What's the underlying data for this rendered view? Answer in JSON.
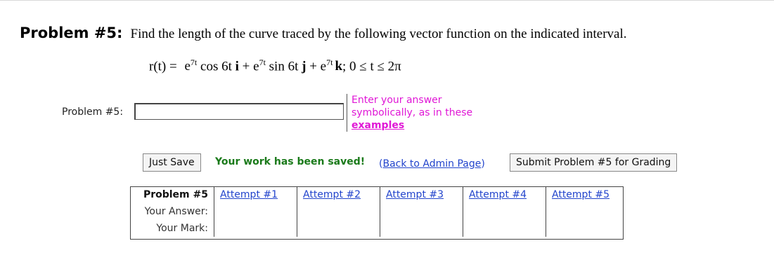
{
  "problem": {
    "heading_label": "Problem #5:",
    "heading_text": "Find the length of the curve traced by the following vector function on the indicated interval."
  },
  "formula": {
    "lhs": "r(t) =",
    "term1_base": "e",
    "term1_exp": "7t",
    "term1_rest": " cos 6t ",
    "term1_vec": "i",
    "plus1": " + ",
    "term2_base": "e",
    "term2_exp": "7t",
    "term2_rest": " sin 6t ",
    "term2_vec": "j",
    "plus2": " + ",
    "term3_base": "e",
    "term3_exp": "7t",
    "term3_vec": "k",
    "interval": "; 0 ≤ t ≤ 2π"
  },
  "answer": {
    "label": "Problem #5:",
    "value": "",
    "placeholder": ""
  },
  "hint": {
    "line1": "Enter your answer",
    "line2": "symbolically, as in these",
    "link": "examples"
  },
  "actions": {
    "just_save": "Just Save",
    "saved_message": "Your work has been saved!",
    "back_link": "Back to Admin Page",
    "submit": "Submit Problem #5 for Grading"
  },
  "attempts_table": {
    "header": "Problem #5",
    "row_answer": "Your Answer:",
    "row_mark": "Your Mark:",
    "attempts": [
      "Attempt #1",
      "Attempt #2",
      "Attempt #3",
      "Attempt #4",
      "Attempt #5"
    ]
  },
  "colors": {
    "hint": "#e017d6",
    "saved": "#1a7a1a",
    "link": "#2244cc"
  }
}
